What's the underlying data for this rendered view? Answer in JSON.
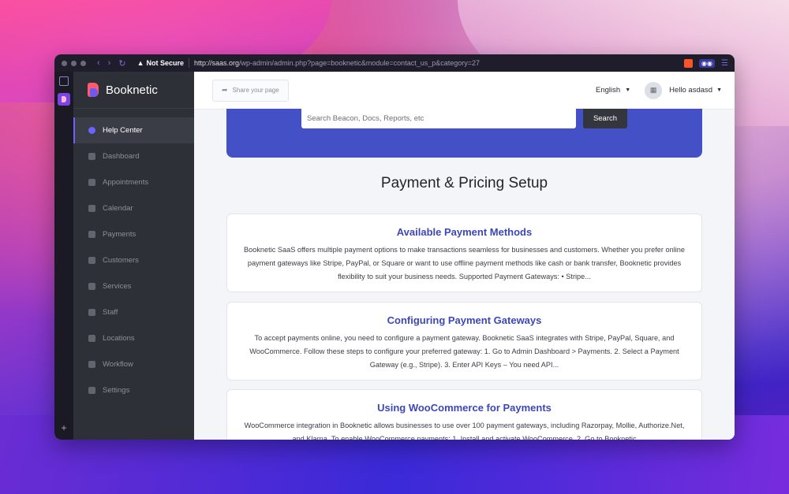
{
  "browser": {
    "security_label": "Not Secure",
    "url_host": "http://saas.org",
    "url_path": "/wp-admin/admin.php?page=booknetic&module=contact_us_p&category=27"
  },
  "app": {
    "name": "Booknetic"
  },
  "sidebar": {
    "items": [
      {
        "label": "Help Center",
        "icon": "help-icon",
        "active": true
      },
      {
        "label": "Dashboard",
        "icon": "dashboard-icon"
      },
      {
        "label": "Appointments",
        "icon": "clock-icon"
      },
      {
        "label": "Calendar",
        "icon": "calendar-icon"
      },
      {
        "label": "Payments",
        "icon": "credit-card-icon"
      },
      {
        "label": "Customers",
        "icon": "users-icon"
      },
      {
        "label": "Services",
        "icon": "list-icon"
      },
      {
        "label": "Staff",
        "icon": "user-icon"
      },
      {
        "label": "Locations",
        "icon": "location-arrow-icon"
      },
      {
        "label": "Workflow",
        "icon": "workflow-icon"
      },
      {
        "label": "Settings",
        "icon": "gear-icon"
      }
    ]
  },
  "topbar": {
    "share_label": "Share your page",
    "language": "English",
    "greeting": "Hello asdasd"
  },
  "search": {
    "placeholder": "Search Beacon, Docs, Reports, etc",
    "button": "Search"
  },
  "page": {
    "title": "Payment & Pricing Setup",
    "articles": [
      {
        "title": "Available Payment Methods",
        "excerpt": "Booknetic SaaS offers multiple payment options to make transactions seamless for businesses and customers. Whether you prefer online payment gateways like Stripe, PayPal, or Square or want to use offline payment methods like cash or bank transfer, Booknetic provides flexibility to suit your business needs. Supported Payment Gateways: • Stripe..."
      },
      {
        "title": "Configuring Payment Gateways",
        "excerpt": "To accept payments online, you need to configure a payment gateway. Booknetic SaaS integrates with Stripe, PayPal, Square, and WooCommerce. Follow these steps to configure your preferred gateway: 1. Go to Admin Dashboard > Payments. 2. Select a Payment Gateway (e.g., Stripe). 3. Enter API Keys – You need API..."
      },
      {
        "title": "Using WooCommerce for Payments",
        "excerpt": "WooCommerce integration in Booknetic allows businesses to use over 100 payment gateways, including Razorpay, Mollie, Authorize.Net, and Klarna. To enable WooCommerce payments: 1. Install and activate WooCommerce. 2. Go to Booknetic"
      }
    ]
  },
  "colors": {
    "accent": "#3d47b8",
    "hero": "#4450c6",
    "sidebar": "#2d3036"
  }
}
